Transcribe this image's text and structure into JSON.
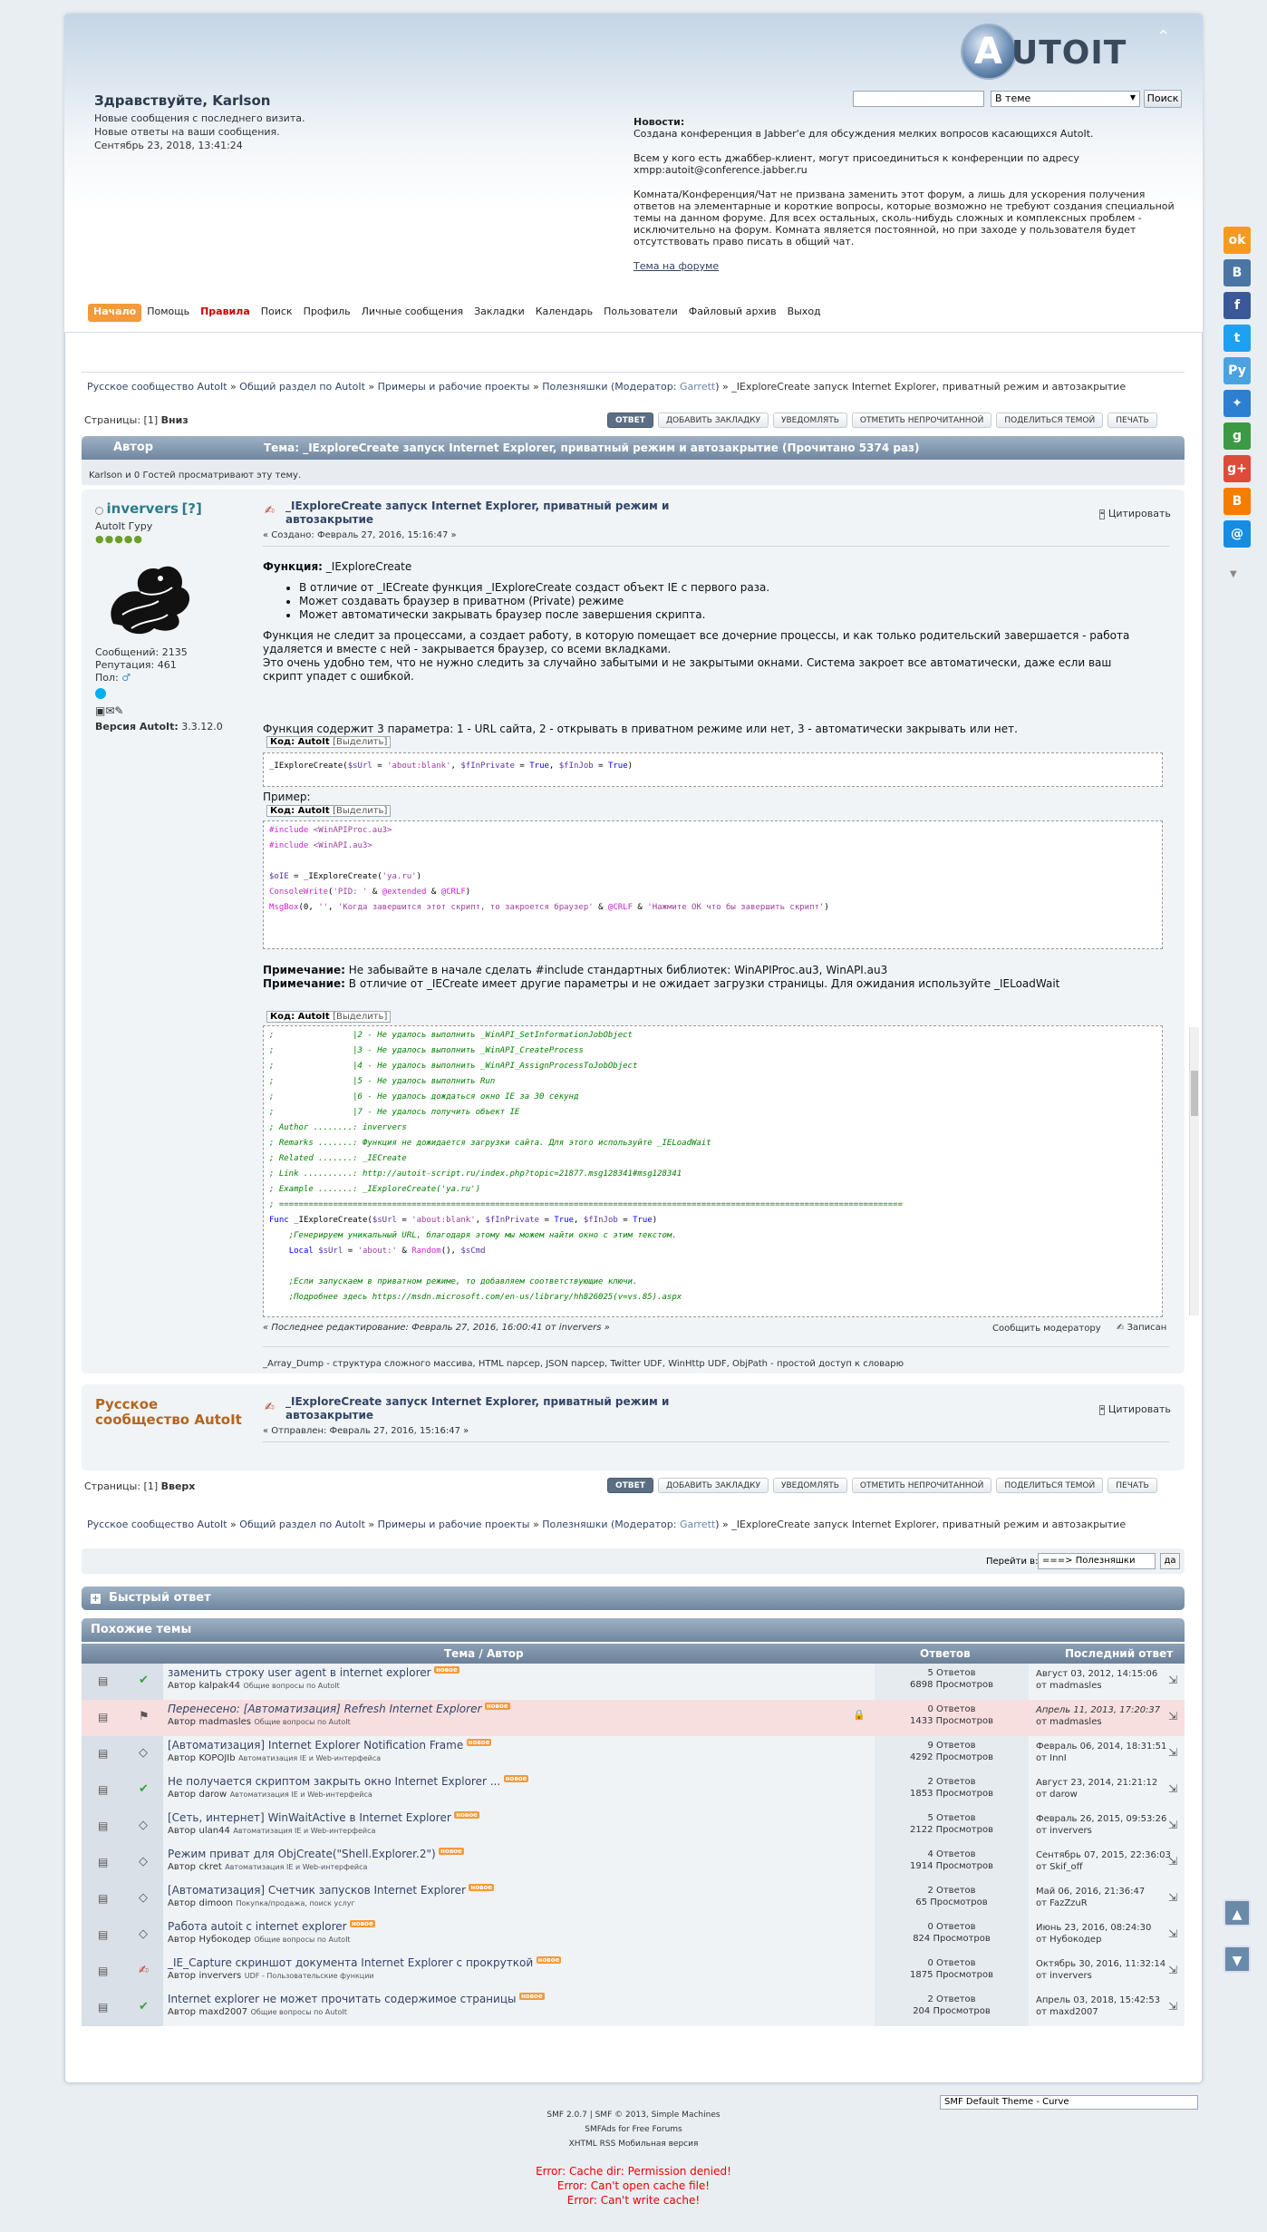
{
  "header": {
    "greeting": "Здравствуйте, Karlson",
    "info1": "Новые сообщения с последнего визита.",
    "info2": "Новые ответы на ваши сообщения.",
    "date": "Сентябрь 23, 2018, 13:41:24",
    "logo_text": "UTOIT",
    "logo_letter": "A",
    "search_scope": "В теме",
    "search_button": "Поиск"
  },
  "news": {
    "title": "Новости:",
    "p1": "Создана конференция в Jabber'е для обсуждения мелких вопросов касающихся AutoIt.",
    "p2": "Всем у кого есть джаббер-клиент, могут присоединиться к конференции по адресу xmpp:autoit@conference.jabber.ru",
    "p3": "Комната/Конференция/Чат не призвана заменить этот форум, а лишь для ускорения получения ответов на элементарные и короткие вопросы, которые возможно не требуют создания специальной темы на данном форуме. Для всех остальных, сколь-нибудь сложных и комплексных проблем - исключительно на форум. Комната является постоянной, но при заходе у пользователя будет отсутствовать право писать в общий чат.",
    "link": "Тема на форуме"
  },
  "menu": [
    "Начало",
    "Помощь",
    "Правила",
    "Поиск",
    "Профиль",
    "Личные сообщения",
    "Закладки",
    "Календарь",
    "Пользователи",
    "Файловый архив",
    "Выход"
  ],
  "linktree": {
    "l1": "Русское сообщество AutoIt",
    "l2": "Общий раздел по AutoIt",
    "l3": "Примеры и рабочие проекты",
    "l4": "Полезняшки (Модератор: ",
    "mod": "Garrett",
    "l4end": ")",
    "l5": "_IExploreCreate запуск Internet Explorer, приватный режим и автозакрытие"
  },
  "pages": {
    "label": "Страницы:",
    "num": "[1]",
    "down": "Вниз",
    "up": "Вверх"
  },
  "buttons": [
    "ответ",
    "добавить закладку",
    "уведомлять",
    "отметить непрочитанной",
    "поделиться темой",
    "печать"
  ],
  "topic": {
    "author_col": "Автор",
    "title": "Тема: _IExploreCreate запуск Internet Explorer, приватный режим и автозакрытие  (Прочитано 5374 раз)",
    "viewers": "Karlson и 0 Гостей просматривают эту тему."
  },
  "post1": {
    "name": "inververs",
    "help": "[?]",
    "rank": "AutoIt Гуру",
    "stars": "●●●●●",
    "msgs": "Сообщений: 2135",
    "rep": "Репутация: 461",
    "sex": "Пол:",
    "version_label": "Версия AutoIt:",
    "version": "3.3.12.0",
    "title": "_IExploreCreate запуск Internet Explorer, приватный режим и автозакрытие",
    "date": "« Создано: Февраль 27, 2016, 15:16:47 »",
    "quote": "Цитировать",
    "func_label": "Функция:",
    "func": "_IExploreCreate",
    "li1": "В отличие от _IECreate функция _IExploreCreate создаст объект IE с первого раза.",
    "li2": "Может создавать браузер в приватном (Private) режиме",
    "li3": "Может автоматически закрывать браузер после завершения скрипта.",
    "p1": "Функция не следит за процессами, а создает работу, в которую помещает все дочерние процессы, и как только родительский завершается - работа удаляется и вместе с ней - закрывается браузер, со всеми вкладками.",
    "p2": "Это очень удобно тем, что не нужно следить за случайно забытыми и не закрытыми окнами. Система закроет все автоматически, даже если ваш скрипт упадет с ошибкой.",
    "p3": "Функция содержит 3 параметра: 1 - URL сайта, 2 - открывать в приватном режиме или нет, 3 - автоматически закрывать или нет.",
    "code_label": "Код: AutoIt",
    "select": "[Выделить]",
    "example": "Пример:",
    "note1_label": "Примечание:",
    "note1": " Не забывайте в начале сделать #include стандартных библиотек: WinAPIProc.au3, WinAPI.au3",
    "note2_label": "Примечание:",
    "note2": " В отличие от _IECreate имеет другие параметры и не ожидает загрузки страницы. Для ожидания используйте _IELoadWait",
    "edited": "« Последнее редактирование: Февраль 27, 2016, 16:00:41 от inververs »",
    "report": "Сообщить модератору",
    "logged": "Записан",
    "sig": "_Array_Dump - структура сложного массива, HTML парсер, JSON парсер, Twitter UDF, WinHttp UDF, ObjPath - простой доступ к словарю"
  },
  "post2": {
    "name": "Русское сообщество AutoIt",
    "title": "_IExploreCreate запуск Internet Explorer, приватный режим и автозакрытие",
    "date": "« Отправлен: Февраль 27, 2016, 15:16:47 »",
    "quote": "Цитировать"
  },
  "jump": {
    "label": "Перейти в:",
    "value": "===> Полезняшки",
    "go": "да"
  },
  "quick_reply": "Быстрый ответ",
  "similar": {
    "title": "Похожие темы",
    "h_topic": "Тема / Автор",
    "h_replies": "Ответов",
    "h_last": "Последний ответ",
    "rows": [
      {
        "t": "заменить строку user agent в internet explorer",
        "by": "Автор",
        "author": "kalpak44",
        "board": "Общие вопросы по AutoIt",
        "rep": "5 Ответов",
        "views": "6898 Просмотров",
        "last": "Август 03, 2012, 14:15:06",
        "lby": "от madmasles",
        "moved": false
      },
      {
        "t": "Перенесено: [Автоматизация] Refresh Internet Explorer",
        "by": "Автор",
        "author": "madmasles",
        "board": "Общие вопросы по AutoIt",
        "rep": "0 Ответов",
        "views": "1433 Просмотров",
        "last": "Апрель 11, 2013, 17:20:37",
        "lby": "от madmasles",
        "moved": true
      },
      {
        "t": "[Автоматизация] Internet Explorer Notification Frame",
        "by": "Автор",
        "author": "KOPOJIb",
        "board": "Автоматизация IE и Web-интерфейса",
        "rep": "9 Ответов",
        "views": "4292 Просмотров",
        "last": "Февраль 06, 2014, 18:31:51",
        "lby": "от InnI",
        "moved": false
      },
      {
        "t": "Не получается скриптом закрыть окно Internet Explorer ...",
        "by": "Автор",
        "author": "darow",
        "board": "Автоматизация IE и Web-интерфейса",
        "rep": "2 Ответов",
        "views": "1853 Просмотров",
        "last": "Август 23, 2014, 21:21:12",
        "lby": "от darow",
        "moved": false
      },
      {
        "t": "[Сеть, интернет] WinWaitActive в Internet Explorer",
        "by": "Автор",
        "author": "ulan44",
        "board": "Автоматизация IE и Web-интерфейса",
        "rep": "5 Ответов",
        "views": "2122 Просмотров",
        "last": "Февраль 26, 2015, 09:53:26",
        "lby": "от inververs",
        "moved": false
      },
      {
        "t": "Режим приват для ObjCreate(\"Shell.Explorer.2\")",
        "by": "Автор",
        "author": "ckret",
        "board": "Автоматизация IE и Web-интерфейса",
        "rep": "4 Ответов",
        "views": "1914 Просмотров",
        "last": "Сентябрь 07, 2015, 22:36:03",
        "lby": "от Skif_off",
        "moved": false
      },
      {
        "t": "[Автоматизация] Счетчик запусков Internet Explorer",
        "by": "Автор",
        "author": "dimoon",
        "board": "Покупка/продажа, поиск услуг",
        "rep": "2 Ответов",
        "views": "65 Просмотров",
        "last": "Май 06, 2016, 21:36:47",
        "lby": "от FazZzuR",
        "moved": false
      },
      {
        "t": "Работа autoit с internet explorer",
        "by": "Автор",
        "author": "Нубокодер",
        "board": "Общие вопросы по AutoIt",
        "rep": "0 Ответов",
        "views": "824 Просмотров",
        "last": "Июнь 23, 2016, 08:24:30",
        "lby": "от Нубокодер",
        "moved": false
      },
      {
        "t": "_IE_Capture скриншот документа Internet Explorer с прокруткой",
        "by": "Автор",
        "author": "inververs",
        "board": "UDF - Пользовательские функции",
        "rep": "0 Ответов",
        "views": "1875 Просмотров",
        "last": "Октябрь 30, 2016, 11:32:14",
        "lby": "от inververs",
        "moved": false
      },
      {
        "t": "Internet explorer не может прочитать содержимое страницы",
        "by": "Автор",
        "author": "maxd2007",
        "board": "Общие вопросы по AutoIt",
        "rep": "2 Ответов",
        "views": "204 Просмотров",
        "last": "Апрель 03, 2018, 15:42:53",
        "lby": "от maxd2007",
        "moved": false
      }
    ]
  },
  "new_badge": "новое",
  "theme_select": "SMF Default Theme - Curve",
  "footer": {
    "l1": "SMF 2.0.7 | SMF © 2013, Simple Machines",
    "l2": "SMFAds for Free Forums",
    "l3": "XHTML   RSS   Мобильная версия"
  },
  "errors": [
    "Error: Cache dir: Permission denied!",
    "Error: Can't open cache file!",
    "Error: Can't write cache!"
  ],
  "colors": {
    "accent": "#f49a3a",
    "link": "#334466",
    "header_bar": "#6f879f",
    "error": "#e00000"
  }
}
